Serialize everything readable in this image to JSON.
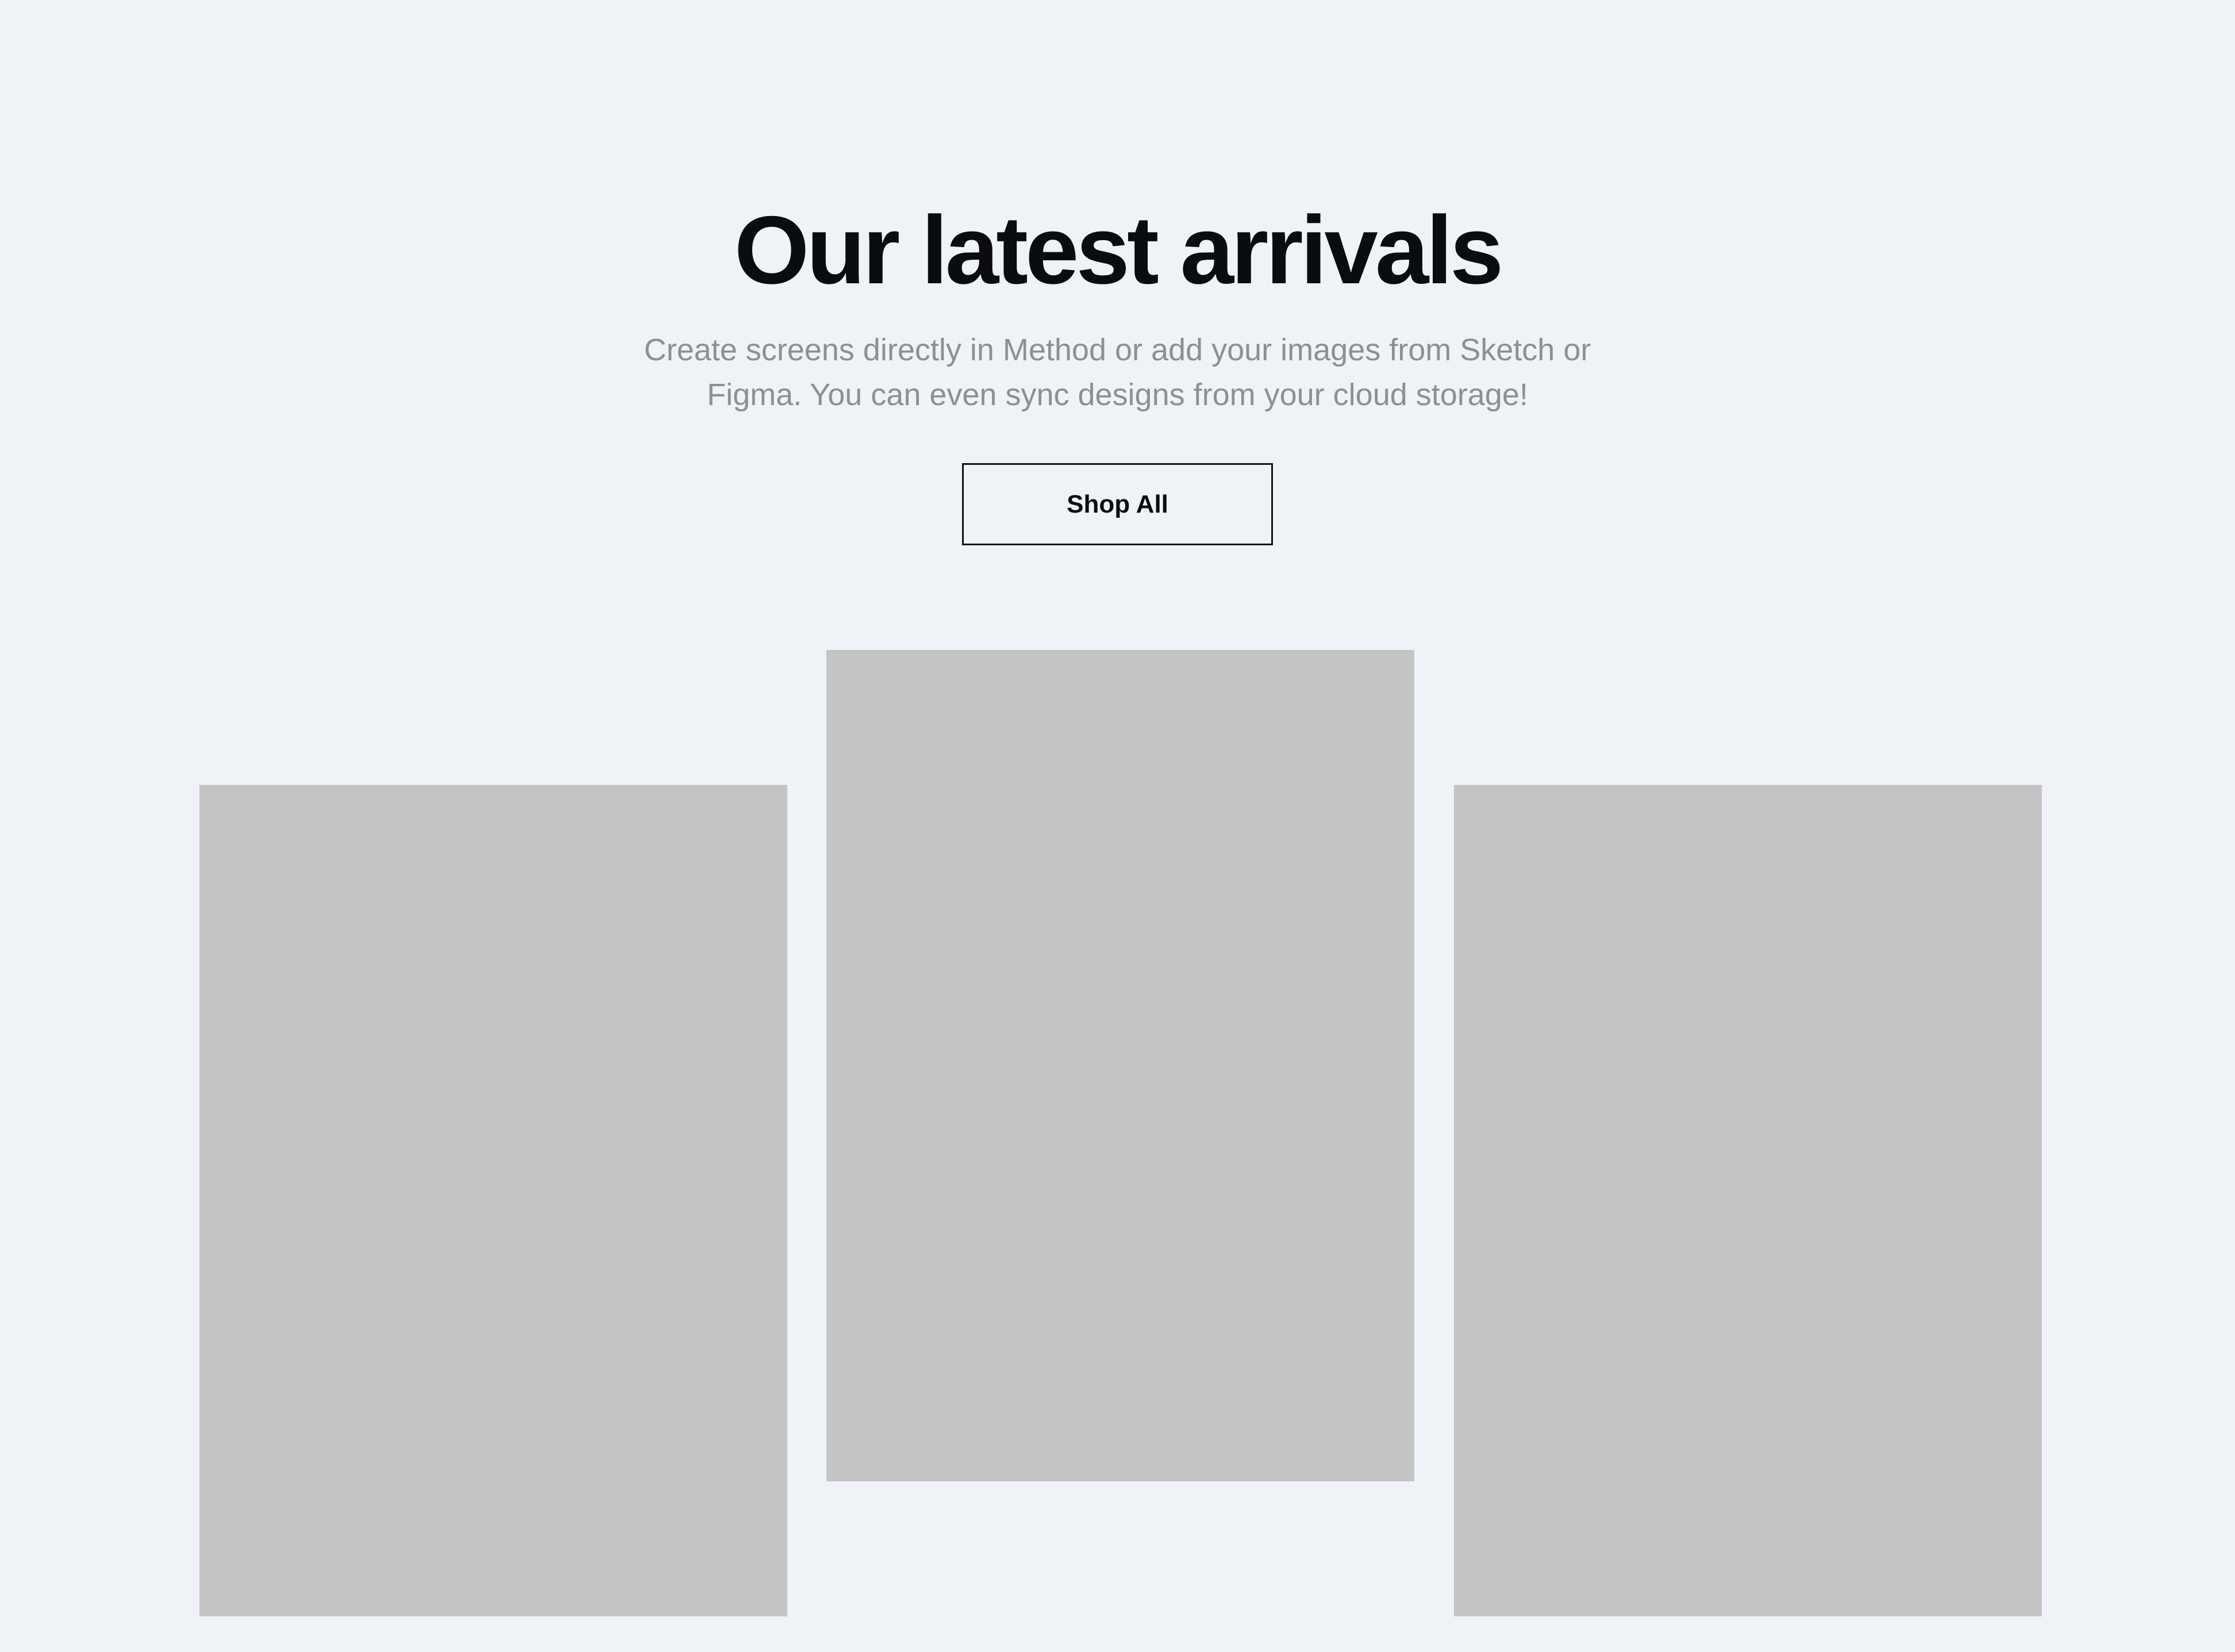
{
  "section": {
    "title": "Our latest arrivals",
    "subtitle": "Create screens directly in Method or add your images from Sketch or Figma. You can even sync designs from your cloud storage!",
    "cta_label": "Shop All"
  },
  "products": [
    {
      "placeholder_color": "#c4c4c4"
    },
    {
      "placeholder_color": "#c4c4c4"
    },
    {
      "placeholder_color": "#c4c4c4"
    }
  ],
  "colors": {
    "background": "#eff2f7",
    "heading": "#0b0c0d",
    "subtitle": "#8e8f92",
    "button_border": "#111214",
    "placeholder": "#c4c4c4"
  }
}
